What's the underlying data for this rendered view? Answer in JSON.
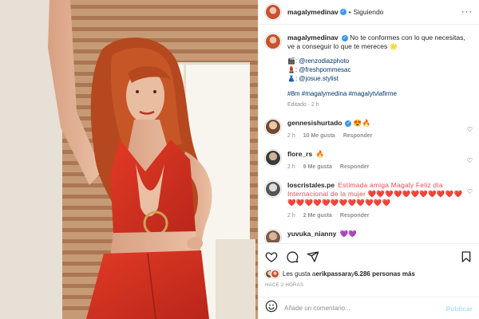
{
  "post": {
    "author": "magalymedinav",
    "follow_label": "Siguiendo",
    "more_label": "···"
  },
  "caption": {
    "text": "No te conformes con lo que necesitas, ve a conseguir lo que te mereces 🌟",
    "credits": [
      {
        "icon": "🎬",
        "handle": "@renzodiazphoto"
      },
      {
        "icon": "💄",
        "handle": "@freshpommesac"
      },
      {
        "icon": "👗",
        "handle": "@josue.stylist"
      }
    ],
    "hashtags": "#8m #magalymedina #magalytvlafirme",
    "edited": "Editado · 2 h"
  },
  "comments": [
    {
      "user": "gennesishurtado",
      "text": "😍🔥",
      "time": "2 h",
      "likes": "10 Me gusta",
      "reply": "Responder"
    },
    {
      "user": "flore_rs",
      "text": "🔥",
      "time": "2 h",
      "likes": "9 Me gusta",
      "reply": "Responder"
    },
    {
      "user": "loscristales.pe",
      "text": "Estimada amiga Magaly Feliz día Internacional de la mujer ❤️❤️❤️❤️❤️❤️❤️❤️❤️❤️❤️❤️❤️❤️❤️❤️❤️❤️❤️❤️❤️❤️❤️",
      "time": "2 h",
      "likes": "2 Me gusta",
      "reply": "Responder"
    },
    {
      "user": "yuvuka_nianny",
      "text": "💜💜"
    }
  ],
  "likes_summary": {
    "prefix": "Les gusta a ",
    "user": "erikpassara",
    "middle": " y ",
    "count": "6.286 personas más"
  },
  "time_ago": "HACE 2 HORAS",
  "composer": {
    "placeholder": "Añade un comentario...",
    "publish_label": "Publicar"
  }
}
